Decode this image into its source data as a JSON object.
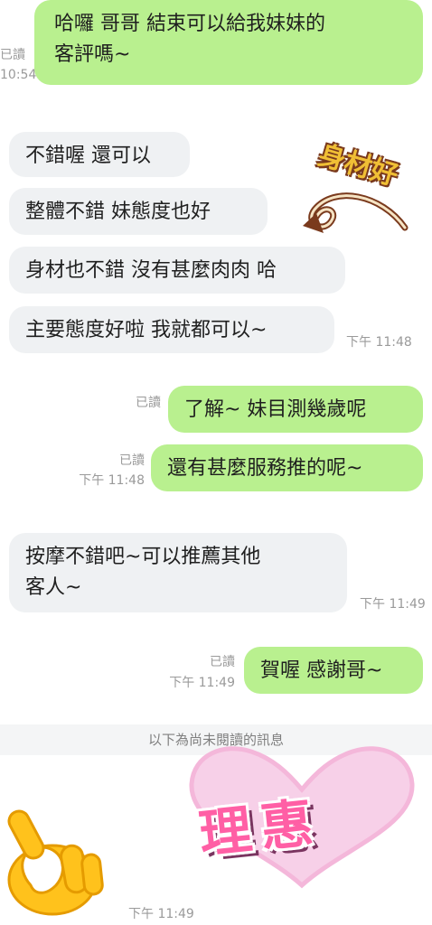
{
  "messages": [
    {
      "text_lines": [
        "哈囉 哥哥 結束可以給我妹妹的",
        "客評嗎~"
      ],
      "read": "已讀",
      "time": "10:54"
    },
    {
      "text": "不錯喔 還可以"
    },
    {
      "text": "整體不錯 妹態度也好"
    },
    {
      "text": "身材也不錯 沒有甚麼肉肉 哈"
    },
    {
      "text": "主要態度好啦 我就都可以~",
      "time": "下午 11:48"
    },
    {
      "text": "了解~ 妹目測幾歲呢",
      "read": "已讀"
    },
    {
      "text": "還有甚麼服務推的呢~",
      "read": "已讀",
      "time": "下午 11:48"
    },
    {
      "text_lines": [
        "按摩不錯吧~可以推薦其他",
        "客人~"
      ],
      "time": "下午 11:49"
    },
    {
      "text": "賀喔 感謝哥~",
      "read": "已讀",
      "time": "下午 11:49"
    }
  ],
  "divider": "以下為尚未閱讀的訊息",
  "last_time": "下午 11:49",
  "stickers": {
    "annotation_text": "身材好",
    "brand_text": "理惠",
    "hand_icon": "ok-hand-icon"
  },
  "colors": {
    "outgoing_bubble": "#b9f08f",
    "incoming_bubble": "#eff1f3",
    "meta_text": "#9a9a9a",
    "brand_pink": "#ff5fa5"
  }
}
